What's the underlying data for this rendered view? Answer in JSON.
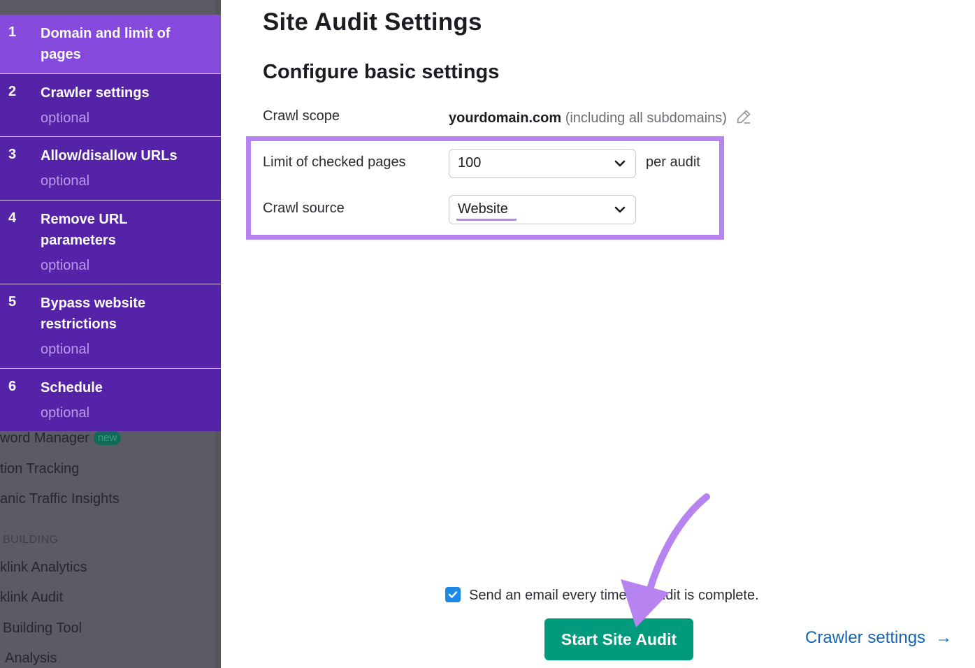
{
  "sidebar": {
    "steps": [
      {
        "number": "1",
        "title": "Domain and limit of pages",
        "subtitle": "",
        "active": true
      },
      {
        "number": "2",
        "title": "Crawler settings",
        "subtitle": "optional",
        "active": false
      },
      {
        "number": "3",
        "title": "Allow/disallow URLs",
        "subtitle": "optional",
        "active": false
      },
      {
        "number": "4",
        "title": "Remove URL parameters",
        "subtitle": "optional",
        "active": false
      },
      {
        "number": "5",
        "title": "Bypass website restrictions",
        "subtitle": "optional",
        "active": false
      },
      {
        "number": "6",
        "title": "Schedule",
        "subtitle": "optional",
        "active": false
      }
    ],
    "background_nav": {
      "items": [
        {
          "label": "word Manager",
          "badge": "new"
        },
        {
          "label": "tion Tracking"
        },
        {
          "label": "anic Traffic Insights"
        }
      ],
      "section": "BUILDING",
      "section_items": [
        {
          "label": "klink Analytics"
        },
        {
          "label": "klink Audit"
        },
        {
          "label": "Building Tool"
        },
        {
          "label": "Analysis"
        }
      ]
    }
  },
  "main": {
    "title": "Site Audit Settings",
    "section_title": "Configure basic settings",
    "crawl_scope": {
      "label": "Crawl scope",
      "domain": "yourdomain.com",
      "note": "(including all subdomains)",
      "edit_icon": "pencil-icon"
    },
    "limit": {
      "label": "Limit of checked pages",
      "value": "100",
      "suffix": "per audit"
    },
    "crawl_source": {
      "label": "Crawl source",
      "value": "Website"
    },
    "email_checkbox": {
      "checked": true,
      "label": "Send an email every time an audit is complete."
    },
    "start_button": "Start Site Audit",
    "next_link": {
      "label": "Crawler settings",
      "arrow": "→"
    }
  },
  "colors": {
    "step_active": "#8549dc",
    "step": "#5523a8",
    "highlight": "#b683f0",
    "primary_button": "#009b7d",
    "link": "#1766b3",
    "checkbox": "#1a8ae6"
  }
}
